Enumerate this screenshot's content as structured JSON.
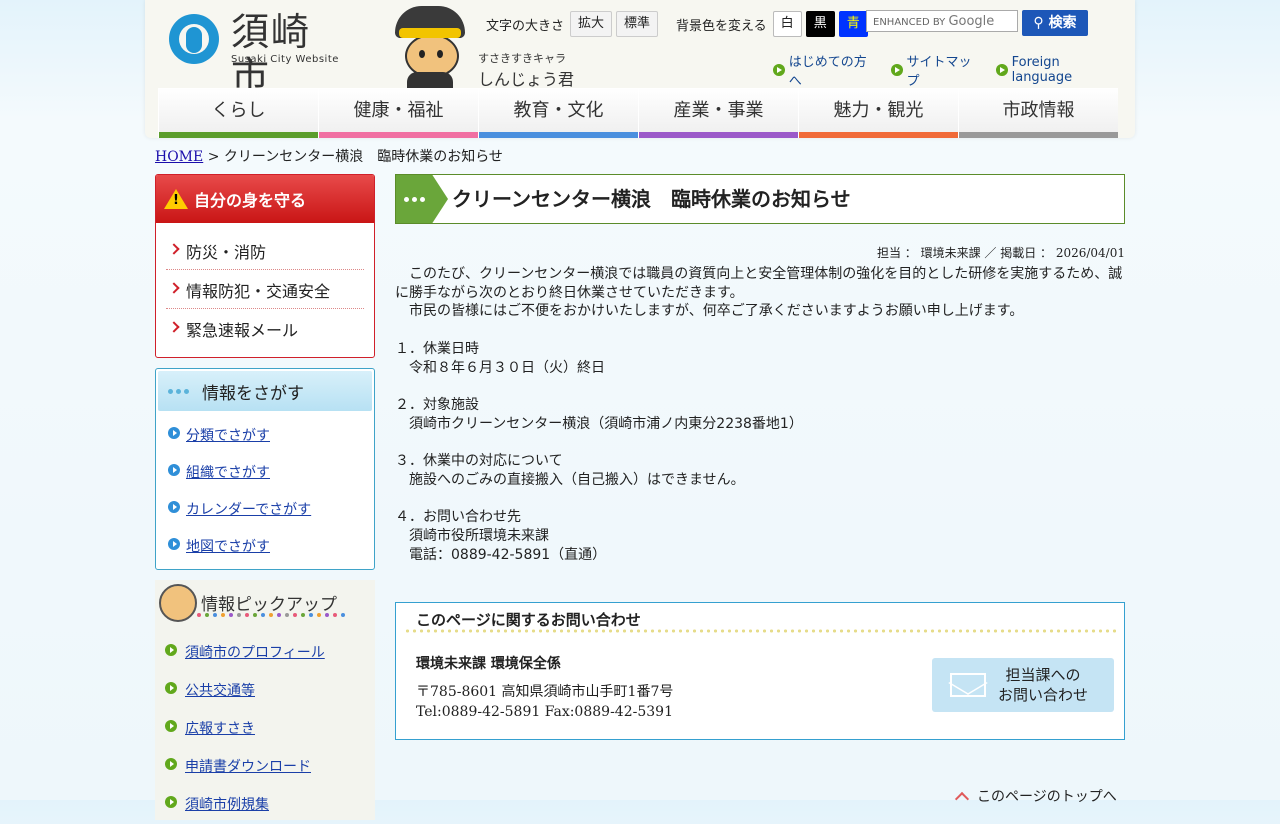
{
  "header": {
    "logo_name": "須崎市",
    "logo_sub": "Susaki City Website",
    "mascot_caption_top": "すさきすきキャラ",
    "mascot_caption_name": "しんじょう君",
    "font_size_label": "文字の大きさ",
    "font_enlarge": "拡大",
    "font_standard": "標準",
    "bg_label": "背景色を変える",
    "bg_white": "白",
    "bg_black": "黒",
    "bg_blue": "青",
    "search_placeholder_prefix": "ENHANCED BY",
    "search_placeholder_brand": "Google",
    "search_button": "検索",
    "quicklinks": [
      "はじめての方へ",
      "サイトマップ",
      "Foreign language"
    ]
  },
  "gnav": [
    {
      "label": "くらし",
      "color": "#5b9d2c"
    },
    {
      "label": "健康・福祉",
      "color": "#f06fa2"
    },
    {
      "label": "教育・文化",
      "color": "#4a8fde"
    },
    {
      "label": "産業・事業",
      "color": "#9b59c9"
    },
    {
      "label": "魅力・観光",
      "color": "#f06a38"
    },
    {
      "label": "市政情報",
      "color": "#999999"
    }
  ],
  "breadcrumb": {
    "home": "HOME",
    "sep": " > ",
    "current": "クリーンセンター横浪　臨時休業のお知らせ"
  },
  "side": {
    "safety_title": "自分の身を守る",
    "safety_items": [
      "防災・消防",
      "情報防犯・交通安全",
      "緊急速報メール"
    ],
    "search_title": "情報をさがす",
    "search_items": [
      "分類でさがす",
      "組織でさがす",
      "カレンダーでさがす",
      "地図でさがす"
    ],
    "pickup_title": "情報ピックアップ",
    "pickup_items": [
      "須崎市のプロフィール",
      "公共交通等",
      "広報すさき",
      "申請書ダウンロード",
      "須崎市例規集"
    ]
  },
  "main": {
    "title": "クリーンセンター横浪　臨時休業のお知らせ",
    "meta": "担当 ： 環境未来課 ／ 掲載日 ： 2026/04/01",
    "body": "　このたび、クリーンセンター横浪では職員の資質向上と安全管理体制の強化を目的とした研修を実施するため、誠に勝手ながら次のとおり終日休業させていただきます。\n　市民の皆様にはご不便をおかけいたしますが、何卒ご了承くださいますようお願い申し上げます。\n\n１．休業日時\n　令和８年６月３０日（火）終日\n\n２．対象施設\n　須崎市クリーンセンター横浪（須崎市浦ノ内東分2238番地1）\n\n３．休業中の対応について\n　施設へのごみの直接搬入（自己搬入）はできません。\n\n４．お問い合わせ先\n　須崎市役所環境未来課\n　電話：0889-42-5891（直通）",
    "contact_title": "このページに関するお問い合わせ",
    "contact_dept": "環境未来課 環境保全係",
    "contact_addr": "〒785-8601 高知県須崎市山手町1番7号",
    "contact_tel": "Tel:0889-42-5891  Fax:0889-42-5391",
    "contact_button_line1": "担当課への",
    "contact_button_line2": "お問い合わせ",
    "pagetop": "このページのトップへ"
  }
}
